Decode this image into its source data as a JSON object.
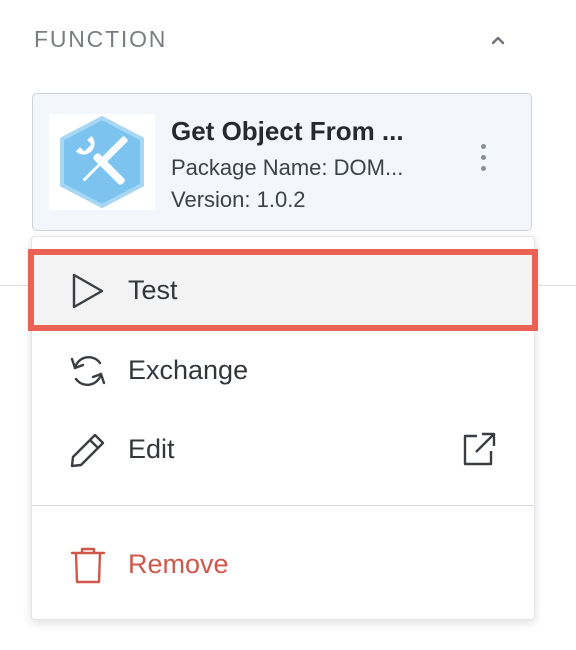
{
  "section": {
    "title": "FUNCTION",
    "collapse_icon": "chevron-up-icon"
  },
  "function_card": {
    "name": "Get Object From ...",
    "package_line": "Package Name: DOM...",
    "version_line": "Version: 1.0.2",
    "thumb_icon": "wrench-screwdriver-hexagon-icon",
    "menu_icon": "kebab-menu-icon"
  },
  "menu": {
    "items": [
      {
        "label": "Test",
        "icon": "play-icon",
        "highlighted": true
      },
      {
        "label": "Exchange",
        "icon": "exchange-icon"
      },
      {
        "label": "Edit",
        "icon": "pencil-icon",
        "trailing_icon": "external-link-icon"
      },
      {
        "label": "Remove",
        "icon": "trash-icon",
        "destructive": true
      }
    ]
  },
  "colors": {
    "highlight_border": "#eb6154",
    "destructive": "#d0584b",
    "card_background": "#f3f6fa",
    "thumb_hex": "#7cc4ef"
  }
}
